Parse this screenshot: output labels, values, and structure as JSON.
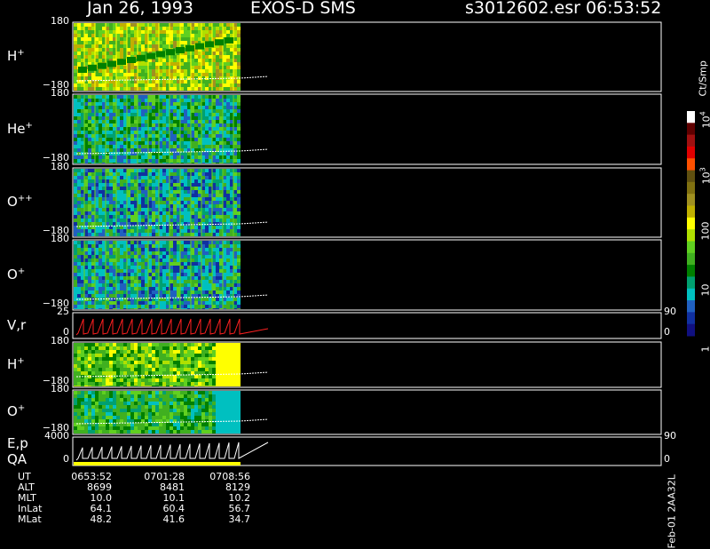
{
  "header": {
    "date": "Jan 26, 1993",
    "instrument": "EXOS-D SMS",
    "file": "s3012602.esr",
    "time": "06:53:52"
  },
  "panels": [
    {
      "label": "H",
      "sup": "+",
      "ytop": "180",
      "ybottom": "−180",
      "kind": "spectro",
      "palette": "h"
    },
    {
      "label": "He",
      "sup": "+",
      "ytop": "180",
      "ybottom": "−180",
      "kind": "spectro",
      "palette": "he"
    },
    {
      "label": "O",
      "sup": "++",
      "ytop": "180",
      "ybottom": "−180",
      "kind": "spectro",
      "palette": "o2"
    },
    {
      "label": "O",
      "sup": "+",
      "ytop": "180",
      "ybottom": "−180",
      "kind": "spectro",
      "palette": "o1"
    },
    {
      "label": "V,r",
      "sup": "",
      "ytop": "25",
      "ybottom": "0",
      "kind": "line",
      "rtop": "90",
      "rbottom": "0"
    },
    {
      "label": "H",
      "sup": "+",
      "ytop": "180",
      "ybottom": "−180",
      "kind": "spectro",
      "palette": "h2"
    },
    {
      "label": "O",
      "sup": "+",
      "ytop": "180",
      "ybottom": "−180",
      "kind": "spectro",
      "palette": "o3"
    },
    {
      "label": "E,p",
      "sup": "",
      "label2": "QA",
      "ytop": "4000",
      "ybottom": "0",
      "kind": "line",
      "rtop": "90",
      "rbottom": "0"
    }
  ],
  "colorbar": {
    "unit": "Ct/Smp",
    "ticks": [
      {
        "label": "1",
        "value": 1
      },
      {
        "label": "10",
        "value": 10
      },
      {
        "label": "100",
        "value": 100
      },
      {
        "label": "10",
        "sup": "3",
        "value": 1000
      },
      {
        "label": "10",
        "sup": "4",
        "value": 10000
      }
    ],
    "colors": [
      "#ffffff",
      "#600000",
      "#a01010",
      "#e00000",
      "#ff5000",
      "#605010",
      "#807010",
      "#a09020",
      "#c0b000",
      "#ffff00",
      "#b0e000",
      "#60d020",
      "#40b020",
      "#008000",
      "#00a070",
      "#00c0c0",
      "#2060c0",
      "#1030a0",
      "#101080"
    ]
  },
  "table": {
    "headers": [
      "UT",
      "ALT",
      "MLT",
      "InLat",
      "MLat"
    ],
    "columns": [
      [
        "0653:52",
        "8699",
        "10.0",
        "64.1",
        "48.2"
      ],
      [
        "0701:28",
        "8481",
        "10.1",
        "60.4",
        "41.6"
      ],
      [
        "0708:56",
        "8129",
        "10.2",
        "56.7",
        "34.7"
      ]
    ]
  },
  "footer_code": "Feb-01 2AA32L",
  "chart_data": {
    "type": "heatmap",
    "title": "Jan 26, 1993 EXOS-D SMS",
    "panels": [
      "H+",
      "He+",
      "O++",
      "O+",
      "V,r",
      "H+",
      "O+",
      "E,p / QA"
    ],
    "ylim_spectrogram": [
      -180,
      180
    ],
    "ylim_vr": [
      0,
      25
    ],
    "ylim_ep": [
      0,
      4000
    ],
    "time_ticks": [
      "0653:52",
      "0701:28",
      "0708:56"
    ],
    "colorbar_scale": "log",
    "colorbar_range": [
      1,
      10000
    ],
    "colorbar_label": "Ct/Smp"
  }
}
